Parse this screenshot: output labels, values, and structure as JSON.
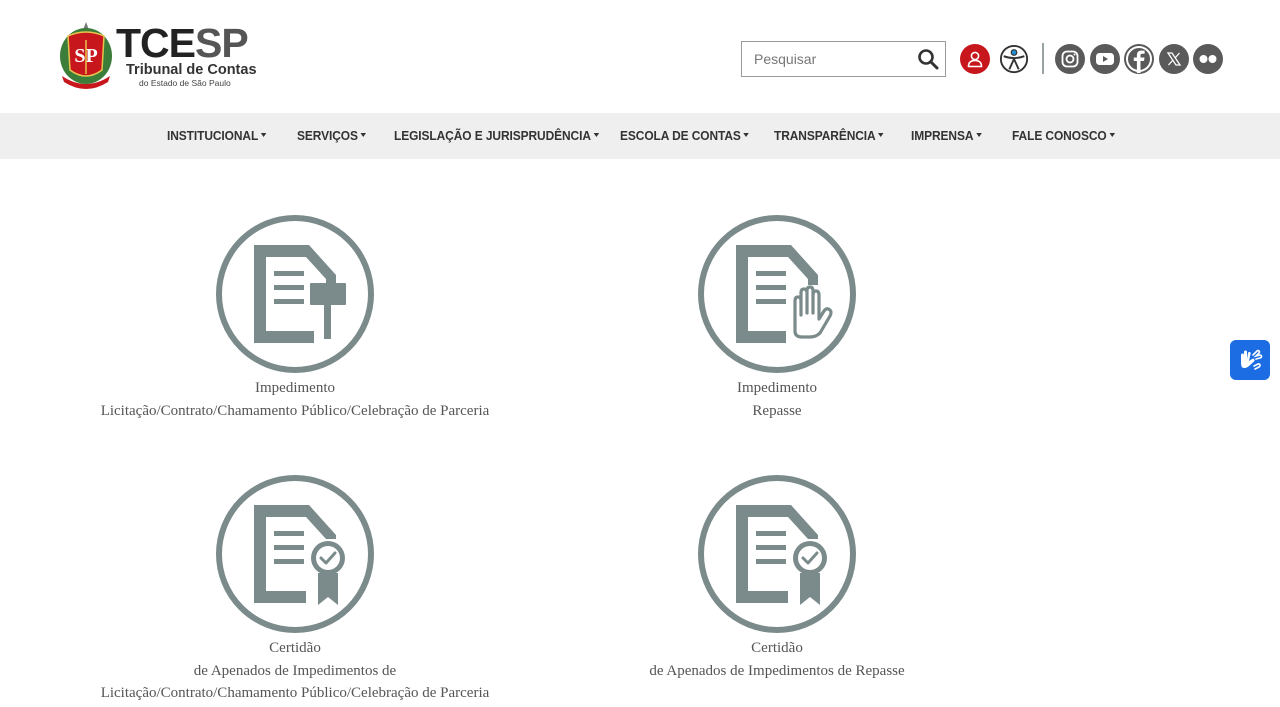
{
  "header": {
    "logo": {
      "seal_text": "SP",
      "brand_main": "TCE",
      "brand_accent": "SP",
      "subtitle": "Tribunal de Contas",
      "subtitle2": "do Estado de São Paulo"
    },
    "search": {
      "placeholder": "Pesquisar",
      "icon": "search-icon"
    },
    "icons": {
      "user": "user-icon",
      "accessibility": "accessibility-icon",
      "social": [
        "instagram-icon",
        "youtube-icon",
        "facebook-icon",
        "x-icon",
        "flickr-icon"
      ]
    },
    "colors": {
      "user_button": "#c8161d",
      "social": "#5a5a5a",
      "badge": "#7b8a8a",
      "vlibras": "#1c6ce3"
    }
  },
  "nav": {
    "items": [
      {
        "label": "INSTITUCIONAL"
      },
      {
        "label": "SERVIÇOS"
      },
      {
        "label": "LEGISLAÇÃO E JURISPRUDÊNCIA"
      },
      {
        "label": "ESCOLA DE CONTAS"
      },
      {
        "label": "TRANSPARÊNCIA"
      },
      {
        "label": "IMPRENSA"
      },
      {
        "label": "FALE CONOSCO"
      }
    ]
  },
  "cards": [
    {
      "icon": "document-gavel-icon",
      "lines": [
        "Impedimento",
        "Licitação/Contrato/Chamamento Público/Celebração de Parceria"
      ]
    },
    {
      "icon": "document-hand-icon",
      "lines": [
        "Impedimento",
        "Repasse"
      ]
    },
    {
      "icon": "document-certificate-icon",
      "lines": [
        "Certidão",
        "de Apenados de Impedimentos de",
        "Licitação/Contrato/Chamamento Público/Celebração de Parceria"
      ]
    },
    {
      "icon": "document-certificate-icon",
      "lines": [
        "Certidão",
        "de Apenados de Impedimentos de Repasse"
      ]
    }
  ],
  "vlibras": {
    "icon": "sign-language-icon"
  }
}
